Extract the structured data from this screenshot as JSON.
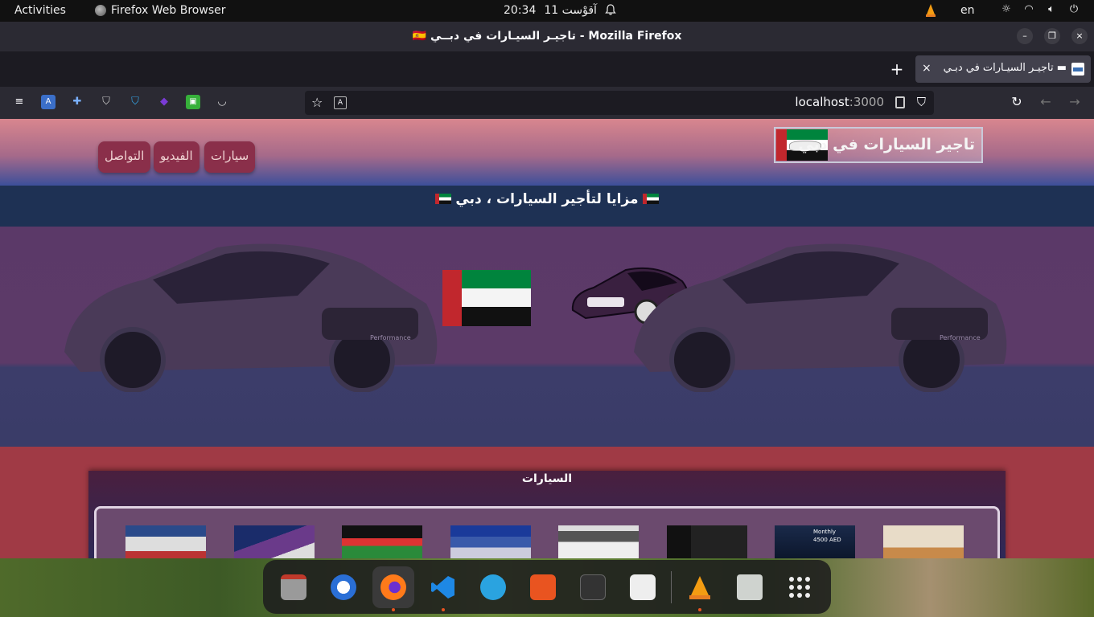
{
  "topbar": {
    "activities": "Activities",
    "app_name": "Firefox Web Browser",
    "time": "20:34",
    "date": "آقوْست 11",
    "language": "en"
  },
  "window": {
    "title": "🇪🇸 تاجيـر السيـارات في دبــي - Mozilla Firefox",
    "minimize": "–",
    "maximize": "❐",
    "close": "×"
  },
  "tab": {
    "label": "تاجيـر السيـارات في دبـي ▬",
    "close": "×",
    "new_tab": "+"
  },
  "urlbar": {
    "host": "localhost",
    "port": ":3000"
  },
  "site": {
    "brand": "تاجير السيارات في دبي",
    "nav": [
      "سيارات",
      "الفيديو",
      "التواصل"
    ],
    "banner": "مزايا لتأجير السيارات ، دبي",
    "cars_heading": "السيارات",
    "thumb_texts": [
      "Monthly",
      "4500 AED"
    ]
  },
  "colors": {
    "header_top": "#d8868e",
    "header_bottom": "#3c4f9a",
    "banner_bg": "#1e3154",
    "hero_bg": "#5b3968",
    "page_bg": "#a03a45",
    "nav_button": "#8a2f4a",
    "firefox_toolbar": "#2b2a33"
  },
  "dock": {
    "items": [
      "files-icon",
      "thunderbird-icon",
      "firefox-icon",
      "vscode-icon",
      "telegram-icon",
      "app-center-icon",
      "terminal-icon",
      "downloads-icon",
      "vlc-icon",
      "trash-icon",
      "app-grid-icon"
    ]
  }
}
